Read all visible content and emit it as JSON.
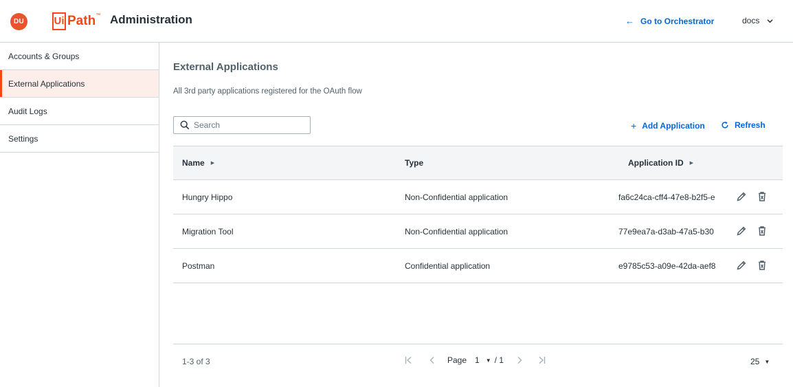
{
  "header": {
    "avatar_initials": "DU",
    "logo_ui": "Ui",
    "logo_path": "Path",
    "logo_tm": "™",
    "app_title": "Administration",
    "goto_label": "Go to Orchestrator",
    "org_name": "docs"
  },
  "sidebar": {
    "items": [
      {
        "label": "Accounts & Groups",
        "active": false
      },
      {
        "label": "External Applications",
        "active": true
      },
      {
        "label": "Audit Logs",
        "active": false
      },
      {
        "label": "Settings",
        "active": false
      }
    ]
  },
  "main": {
    "title": "External Applications",
    "description": "All 3rd party applications registered for the OAuth flow",
    "search_placeholder": "Search",
    "add_label": "Add Application",
    "refresh_label": "Refresh"
  },
  "table": {
    "columns": [
      "Name",
      "Type",
      "Application ID"
    ],
    "rows": [
      {
        "name": "Hungry Hippo",
        "type": "Non-Confidential application",
        "app_id": "fa6c24ca-cff4-47e8-b2f5-e"
      },
      {
        "name": "Migration Tool",
        "type": "Non-Confidential application",
        "app_id": "77e9ea7a-d3ab-47a5-b30"
      },
      {
        "name": "Postman",
        "type": "Confidential application",
        "app_id": "e9785c53-a09e-42da-aef8"
      }
    ]
  },
  "pagination": {
    "count": "1-3 of 3",
    "page_label": "Page",
    "current_page": "1",
    "total_pages": "/ 1",
    "per_page": "25"
  },
  "colors": {
    "brand": "#fa4616",
    "accent": "#0067df",
    "active_bg": "#fdeee9"
  }
}
